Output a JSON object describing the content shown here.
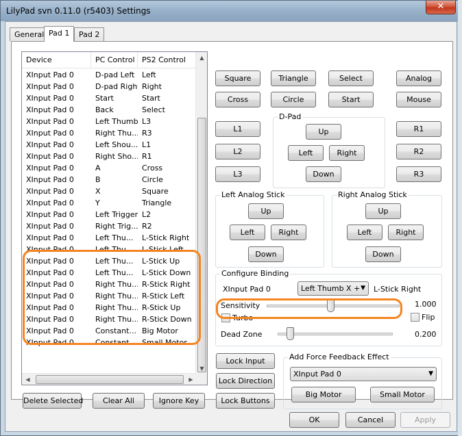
{
  "window": {
    "title": "LilyPad svn 0.11.0 (r5403) Settings",
    "close_glyph": "✕"
  },
  "tabs": [
    {
      "label": "General"
    },
    {
      "label": "Pad 1"
    },
    {
      "label": "Pad 2"
    }
  ],
  "list": {
    "headers": [
      "Device",
      "PC Control",
      "PS2 Control"
    ],
    "rows": [
      [
        "XInput Pad 0",
        "D-pad Left",
        "Left"
      ],
      [
        "XInput Pad 0",
        "D-pad Right",
        "Right"
      ],
      [
        "XInput Pad 0",
        "Start",
        "Start"
      ],
      [
        "XInput Pad 0",
        "Back",
        "Select"
      ],
      [
        "XInput Pad 0",
        "Left Thumb",
        "L3"
      ],
      [
        "XInput Pad 0",
        "Right Thu...",
        "R3"
      ],
      [
        "XInput Pad 0",
        "Left Shou...",
        "L1"
      ],
      [
        "XInput Pad 0",
        "Right Sho...",
        "R1"
      ],
      [
        "XInput Pad 0",
        "A",
        "Cross"
      ],
      [
        "XInput Pad 0",
        "B",
        "Circle"
      ],
      [
        "XInput Pad 0",
        "X",
        "Square"
      ],
      [
        "XInput Pad 0",
        "Y",
        "Triangle"
      ],
      [
        "XInput Pad 0",
        "Left Trigger",
        "L2"
      ],
      [
        "XInput Pad 0",
        "Right Trig...",
        "R2"
      ],
      [
        "XInput Pad 0",
        "Left Thu...",
        "L-Stick Right"
      ],
      [
        "XInput Pad 0",
        "Left Thu...",
        "L-Stick Left"
      ],
      [
        "XInput Pad 0",
        "Left Thu...",
        "L-Stick Up"
      ],
      [
        "XInput Pad 0",
        "Left Thu...",
        "L-Stick Down"
      ],
      [
        "XInput Pad 0",
        "Right Thu...",
        "R-Stick Right"
      ],
      [
        "XInput Pad 0",
        "Right Thu...",
        "R-Stick Left"
      ],
      [
        "XInput Pad 0",
        "Right Thu...",
        "R-Stick Up"
      ],
      [
        "XInput Pad 0",
        "Right Thu...",
        "R-Stick Down"
      ],
      [
        "XInput Pad 0",
        "Constant...",
        "Big Motor"
      ],
      [
        "XInput Pad 0",
        "Constant...",
        "Small Motor"
      ]
    ]
  },
  "list_buttons": {
    "delete": "Delete Selected",
    "clear": "Clear All",
    "ignore": "Ignore Key"
  },
  "face_buttons": {
    "square": "Square",
    "triangle": "Triangle",
    "select": "Select",
    "analog": "Analog",
    "cross": "Cross",
    "circle": "Circle",
    "start": "Start",
    "mouse": "Mouse",
    "l1": "L1",
    "l2": "L2",
    "l3": "L3",
    "r1": "R1",
    "r2": "R2",
    "r3": "R3"
  },
  "dpad": {
    "label": "D-Pad",
    "up": "Up",
    "left": "Left",
    "right": "Right",
    "down": "Down"
  },
  "left_stick": {
    "label": "Left Analog Stick",
    "up": "Up",
    "left": "Left",
    "right": "Right",
    "down": "Down"
  },
  "right_stick": {
    "label": "Right Analog Stick",
    "up": "Up",
    "left": "Left",
    "right": "Right",
    "down": "Down"
  },
  "binding": {
    "label": "Configure Binding",
    "device": "XInput Pad 0",
    "control": "Left Thumb X +",
    "target": "L-Stick Right",
    "sensitivity_label": "Sensitivity",
    "sensitivity_value": "1.000",
    "sensitivity_level": 0.48,
    "turbo_label": "Turbo",
    "flip_label": "Flip",
    "deadzone_label": "Dead Zone",
    "deadzone_value": "0.200",
    "deadzone_level": 0.08
  },
  "lock_buttons": {
    "input": "Lock Input",
    "direction": "Lock Direction",
    "buttons": "Lock Buttons"
  },
  "force_feedback": {
    "label": "Add Force Feedback Effect",
    "device": "XInput Pad 0",
    "big": "Big Motor",
    "small": "Small Motor"
  },
  "dialog": {
    "ok": "OK",
    "cancel": "Cancel",
    "apply": "Apply"
  },
  "colors": {
    "highlight": "#f5841f"
  }
}
